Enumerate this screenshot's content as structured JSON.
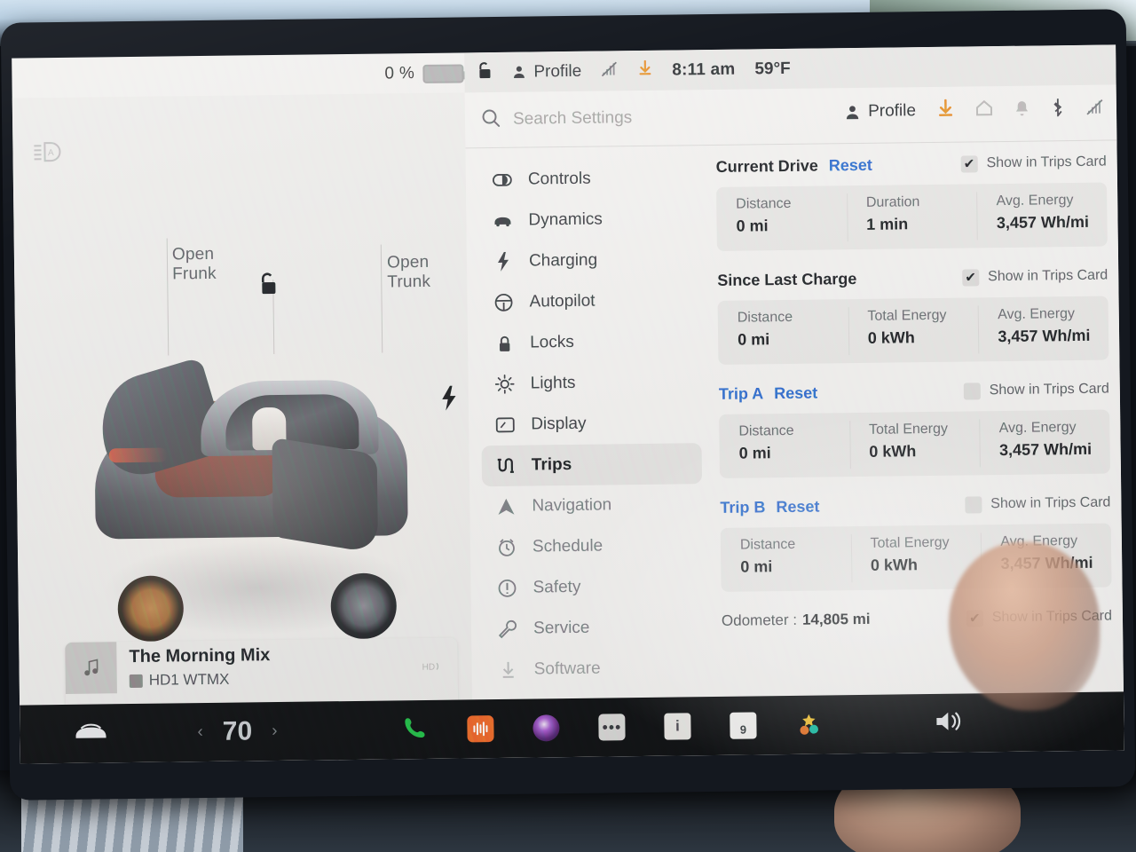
{
  "statusbar": {
    "battery_pct": "0 %",
    "lock_icon": "unlock-icon",
    "profile_label": "Profile",
    "signal_icon": "cellular-off-icon",
    "download_icon": "software-update-icon",
    "time": "8:11 am",
    "temperature": "59°F"
  },
  "car_panel": {
    "auto_headlight_icon": "auto-headlight-icon",
    "open_frunk": "Open\nFrunk",
    "open_frunk_line1": "Open",
    "open_frunk_line2": "Frunk",
    "open_trunk_line1": "Open",
    "open_trunk_line2": "Trunk",
    "lock_icon": "unlock-icon",
    "charge_port_icon": "charge-bolt-icon"
  },
  "media": {
    "title": "The Morning Mix",
    "station": "HD1 WTMX",
    "hd_indicator": "HD",
    "controls": [
      "prev-icon",
      "stop-icon",
      "next-icon",
      "favorite-icon",
      "equalizer-icon",
      "search-icon"
    ]
  },
  "settings": {
    "search": {
      "placeholder": "Search Settings",
      "icon": "search-icon"
    },
    "header_icons": [
      {
        "name": "profile-icon",
        "label": "Profile"
      },
      {
        "name": "software-update-icon",
        "label": ""
      },
      {
        "name": "home-icon",
        "label": ""
      },
      {
        "name": "notification-bell-icon",
        "label": ""
      },
      {
        "name": "bluetooth-icon",
        "label": ""
      },
      {
        "name": "cellular-off-icon",
        "label": ""
      }
    ],
    "nav": [
      {
        "label": "Controls",
        "icon": "controls-icon",
        "state": "normal"
      },
      {
        "label": "Dynamics",
        "icon": "car-front-icon",
        "state": "normal"
      },
      {
        "label": "Charging",
        "icon": "bolt-icon",
        "state": "normal"
      },
      {
        "label": "Autopilot",
        "icon": "steering-wheel-icon",
        "state": "normal"
      },
      {
        "label": "Locks",
        "icon": "lock-icon",
        "state": "normal"
      },
      {
        "label": "Lights",
        "icon": "lights-icon",
        "state": "normal"
      },
      {
        "label": "Display",
        "icon": "display-icon",
        "state": "normal"
      },
      {
        "label": "Trips",
        "icon": "trips-icon",
        "state": "active"
      },
      {
        "label": "Navigation",
        "icon": "navigation-arrow-icon",
        "state": "normal"
      },
      {
        "label": "Schedule",
        "icon": "schedule-clock-icon",
        "state": "dim"
      },
      {
        "label": "Safety",
        "icon": "safety-alert-icon",
        "state": "dim"
      },
      {
        "label": "Service",
        "icon": "wrench-icon",
        "state": "dim"
      },
      {
        "label": "Software",
        "icon": "software-download-icon",
        "state": "fade"
      }
    ],
    "show_in_trips_card_label": "Show in Trips Card",
    "reset_label": "Reset",
    "sections": [
      {
        "title": "Current Drive",
        "has_reset": true,
        "title_color": "dark",
        "show_in_trips_card": true,
        "stats": [
          {
            "label": "Distance",
            "value": "0 mi"
          },
          {
            "label": "Duration",
            "value": "1 min"
          },
          {
            "label": "Avg. Energy",
            "value": "3,457 Wh/mi"
          }
        ]
      },
      {
        "title": "Since Last Charge",
        "has_reset": false,
        "title_color": "dark",
        "show_in_trips_card": true,
        "stats": [
          {
            "label": "Distance",
            "value": "0 mi"
          },
          {
            "label": "Total Energy",
            "value": "0 kWh"
          },
          {
            "label": "Avg. Energy",
            "value": "3,457 Wh/mi"
          }
        ]
      },
      {
        "title": "Trip A",
        "has_reset": true,
        "title_color": "blue",
        "show_in_trips_card": false,
        "stats": [
          {
            "label": "Distance",
            "value": "0 mi"
          },
          {
            "label": "Total Energy",
            "value": "0 kWh"
          },
          {
            "label": "Avg. Energy",
            "value": "3,457 Wh/mi"
          }
        ]
      },
      {
        "title": "Trip B",
        "has_reset": true,
        "title_color": "blue",
        "show_in_trips_card": false,
        "stats": [
          {
            "label": "Distance",
            "value": "0 mi"
          },
          {
            "label": "Total Energy",
            "value": "0 kWh"
          },
          {
            "label": "Avg. Energy",
            "value": "3,457 Wh/mi"
          }
        ]
      }
    ],
    "odometer": {
      "label": "Odometer :",
      "value": "14,805 mi",
      "show_in_trips_card": true
    }
  },
  "taskbar": {
    "car_icon": "car-icon",
    "temp_decrease": "‹",
    "temperature": "70",
    "temp_increase": "›",
    "phone_icon": "phone-icon",
    "media_icon": "media-waveform-icon",
    "dashcam_icon": "dashcam-icon",
    "more_icon": "more-dots-icon",
    "notes_icon": "notes-icon",
    "calendar_icon": "calendar-icon",
    "calendar_day": "9",
    "toybox_icon": "toybox-icon",
    "volume_icon": "volume-icon"
  },
  "colors": {
    "accent_blue": "#2f6fd0",
    "update_orange": "#e8932b",
    "phone_green": "#25c04a",
    "media_orange": "#ef6b2b",
    "screen_bg": "#f2f1ef",
    "card_bg": "#e9e8e6"
  }
}
